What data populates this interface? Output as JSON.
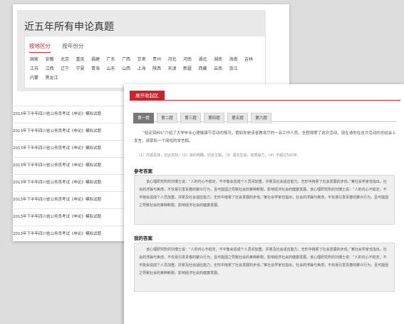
{
  "exam": {
    "title": "近五年所有申论真题",
    "tabs": [
      "按地区分",
      "按年份分"
    ],
    "regions": [
      "国家",
      "安徽",
      "北京",
      "重庆",
      "福建",
      "广东",
      "广西",
      "甘肃",
      "贵州",
      "河北",
      "河南",
      "湖北",
      "湖南",
      "海南",
      "吉林",
      "江苏",
      "江西",
      "辽宁",
      "宁夏",
      "青海",
      "山东",
      "山西",
      "上海",
      "陕西",
      "天津",
      "新疆",
      "西藏",
      "云南",
      "浙江",
      "内蒙",
      "黑龙江"
    ]
  },
  "list": [
    "2013年下半年四川省公务员考试《申论》模拟试题",
    "2013年下半年四川省公务员考试《申论》模拟试题",
    "2013年下半年四川省公务员考试《申论》模拟试题",
    "2013年下半年四川省公务员考试《申论》模拟试题",
    "2013年下半年四川省公务员考试《申论》模拟试题",
    "2013年下半年四川省公务员考试《申论》模拟试题",
    "2013年下半年四川省公务员考试《申论》模拟试题",
    "2013年下半年四川省公务员考试《申论》模拟试题"
  ],
  "panel": {
    "expand_label": "展开收起区",
    "question_tabs": [
      "第一题",
      "第二题",
      "第三题",
      "第四题",
      "第五题",
      "第六题"
    ],
    "question_text": "“给定资料5”介绍了大学毕业心理健康节活动的情况，假如你是该省教育厅的一名工作人员，全程观摩了这次活动，现在请你在这次活动的总结会上发言，请草拟一个简短的发言稿。",
    "hints": "（1）内容具体，切合实际；（2）目的明确，切合主题；（3）语言生动，有感染力；（4）不超过500字。",
    "reference_label": "参考答案",
    "reference_text": "该心理研究所的刘博士说：“人的内心不稳定，不平衡会造成个人员间加重，并累及社会适应能力，无形中拖累了社会发展的步伐。”某社会学家也指出，社会的浮躁与焦虑，不仅易引发青春的聚众行为，且可能因之导致社会的某种断裂，影响经济社会的健康发展。该心理研究所的刘博士说：“人的内心不稳定，不平衡会造成个人员加重，并累及社会适应能力，无形中拖累了社会发展的步伐。”某社会学家也指出，社会的浮躁与焦虑，不仅易引发青春的聚众行为，且可能因之导致社会的某种断裂，影响经济社会的健康发展。",
    "my_label": "我的答案",
    "my_text": "该心理研究所的刘博士说：“人的内心不稳定，不平衡会造成个人员间加重，并累及社会适应能力，无形中拖累了社会发展的步伐。”某社会学家也指出，社会的浮躁与焦虑，不仅易引发青春的聚众行为，且可能因之导致社会的某种断裂，影响经济社会的健康发展。该心理研究所的刘博士说：“人的内心不稳定，不平衡会造成个人员加重，并累及社会适应能力，无形中拖累了社会发展的步伐。”某社会学家也指出，社会的浮躁与焦虑，不仅易引发青春的聚众行为，且可能因之导致社会的某种断裂，影响经济社会的健康发展。"
  },
  "colors": {
    "accent": "#c9242c"
  }
}
